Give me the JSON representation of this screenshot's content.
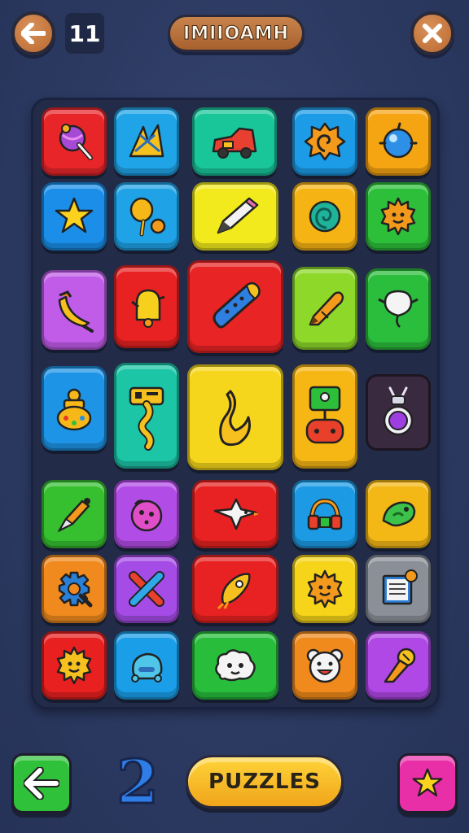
{
  "header": {
    "back_icon": "arrow-left-icon",
    "level_number": "11",
    "title": "IMIIOAMH",
    "close_icon": "close-x-icon"
  },
  "board": {
    "tiles": [
      {
        "row": 0,
        "col": 0,
        "color": "#e8262a",
        "icon": "lollipop-icon"
      },
      {
        "row": 0,
        "col": 1,
        "color": "#1fa4e8",
        "icon": "scissors-icon"
      },
      {
        "row": 0,
        "col": 2,
        "color": "#19c69a",
        "icon": "toy-car-icon"
      },
      {
        "row": 0,
        "col": 3,
        "color": "#1c9be6",
        "icon": "spiral-shell-icon"
      },
      {
        "row": 0,
        "col": 4,
        "color": "#f5a412",
        "icon": "blue-blob-icon"
      },
      {
        "row": 1,
        "col": 0,
        "color": "#1a8ee8",
        "icon": "star-icon"
      },
      {
        "row": 1,
        "col": 1,
        "color": "#1fa2e6",
        "icon": "paddle-ball-icon"
      },
      {
        "row": 1,
        "col": 2,
        "color": "#f2ea1c",
        "icon": "pencil-icon"
      },
      {
        "row": 1,
        "col": 3,
        "color": "#f6b414",
        "icon": "teal-swirl-icon"
      },
      {
        "row": 1,
        "col": 4,
        "color": "#2dbf3a",
        "icon": "sun-face-icon"
      },
      {
        "row": 2,
        "col": 0,
        "color": "#c05ce8",
        "icon": "banana-icon"
      },
      {
        "row": 2,
        "col": 1,
        "color": "#e82222",
        "icon": "bell-icon"
      },
      {
        "row": 2,
        "col": 2,
        "color": "#e82424",
        "icon": "skateboard-icon"
      },
      {
        "row": 2,
        "col": 3,
        "color": "#8ed82a",
        "icon": "crayon-icon"
      },
      {
        "row": 2,
        "col": 4,
        "color": "#2bbd3c",
        "icon": "balloon-icon"
      },
      {
        "row": 3,
        "col": 0,
        "color": "#1e94e6",
        "icon": "gourd-icon"
      },
      {
        "row": 3,
        "col": 1,
        "color": "#1bc5a6",
        "icon": "key-icon"
      },
      {
        "row": 3,
        "col": 2,
        "color": "#f6d61c",
        "icon": "squiggle-icon"
      },
      {
        "row": 3,
        "col": 3,
        "color": "#f6b614",
        "icon": "robot-controller-icon"
      },
      {
        "row": 3,
        "col": 4,
        "color": "#3a2a40",
        "icon": "ring-bug-icon"
      },
      {
        "row": 4,
        "col": 0,
        "color": "#36c030",
        "icon": "fountain-pen-icon"
      },
      {
        "row": 4,
        "col": 1,
        "color": "#b24ce6",
        "icon": "purple-ball-icon"
      },
      {
        "row": 4,
        "col": 2,
        "color": "#e82222",
        "icon": "bird-icon"
      },
      {
        "row": 4,
        "col": 3,
        "color": "#1c9ae4",
        "icon": "headphones-icon"
      },
      {
        "row": 4,
        "col": 4,
        "color": "#f4b816",
        "icon": "green-fish-icon"
      },
      {
        "row": 5,
        "col": 0,
        "color": "#f08a1e",
        "icon": "gear-icon"
      },
      {
        "row": 5,
        "col": 1,
        "color": "#a54ce6",
        "icon": "cross-sticks-icon"
      },
      {
        "row": 5,
        "col": 2,
        "color": "#e82222",
        "icon": "rocket-icon"
      },
      {
        "row": 5,
        "col": 3,
        "color": "#f6d41a",
        "icon": "sun-face-icon"
      },
      {
        "row": 5,
        "col": 4,
        "color": "#8a8f98",
        "icon": "notepad-icon"
      },
      {
        "row": 6,
        "col": 0,
        "color": "#e82020",
        "icon": "sun-face-icon"
      },
      {
        "row": 6,
        "col": 1,
        "color": "#1a9ee8",
        "icon": "blue-creature-icon"
      },
      {
        "row": 6,
        "col": 2,
        "color": "#28be3c",
        "icon": "cloud-face-icon"
      },
      {
        "row": 6,
        "col": 3,
        "color": "#f08a1c",
        "icon": "bear-face-icon"
      },
      {
        "row": 6,
        "col": 4,
        "color": "#b048e6",
        "icon": "ice-cream-icon"
      }
    ]
  },
  "footer": {
    "back_icon": "arrow-left-icon",
    "counter": "2",
    "puzzles_label": "PUZZLES",
    "star_icon": "star-icon"
  },
  "colors": {
    "background": "#2c3a62",
    "board": "#222c49",
    "accent_orange": "#c17136",
    "button_green": "#2fc13a",
    "button_pink": "#e82fa8",
    "button_yellow": "#f7c02a"
  }
}
